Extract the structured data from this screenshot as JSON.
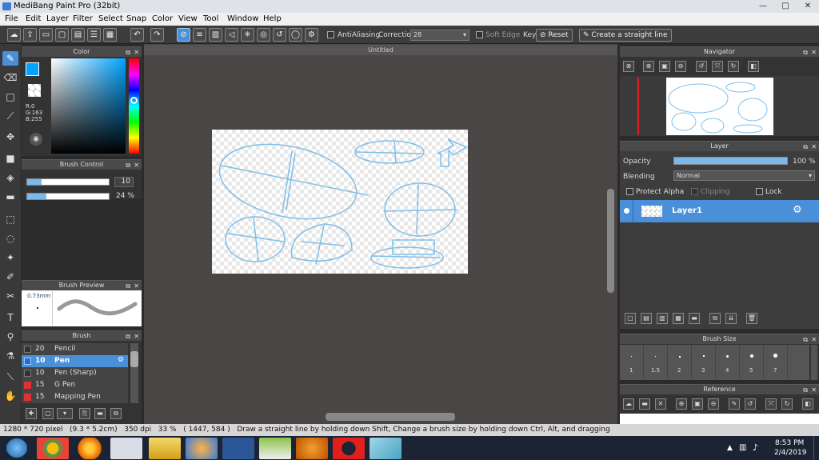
{
  "window": {
    "title": "MediBang Paint Pro (32bit)",
    "minimize": "—",
    "maximize": "□",
    "close": "✕"
  },
  "menu": [
    "File",
    "Edit",
    "Layer",
    "Filter",
    "Select",
    "Snap",
    "Color",
    "View",
    "Tool",
    "Window",
    "Help"
  ],
  "toolbar": {
    "antialiasing": "AntiAliasing",
    "correction_label": "Correction",
    "correction_value": "28",
    "soft_edge": "Soft Edge",
    "key": "Key",
    "reset": "Reset",
    "straight": "Create a straight line"
  },
  "color_panel": {
    "title": "Color",
    "r": "R:0",
    "g": "G:163",
    "b": "B:255",
    "accent": "#00a3ff"
  },
  "brush_control": {
    "title": "Brush Control",
    "size": "10",
    "opacity": "24 %"
  },
  "brush_preview": {
    "title": "Brush Preview",
    "size": "0.73mm"
  },
  "brush_panel": {
    "title": "Brush",
    "items": [
      {
        "size": "20",
        "name": "Pencil",
        "color": "#333333"
      },
      {
        "size": "10",
        "name": "Pen",
        "color": "#4a90d9",
        "selected": true
      },
      {
        "size": "10",
        "name": "Pen (Sharp)",
        "color": "#333333"
      },
      {
        "size": "15",
        "name": "G Pen",
        "color": "#e03030"
      },
      {
        "size": "15",
        "name": "Mapping Pen",
        "color": "#e03030"
      }
    ]
  },
  "document": {
    "tab": "Untitled"
  },
  "navigator": {
    "title": "Navigator"
  },
  "layer_panel": {
    "title": "Layer",
    "opacity_label": "Opacity",
    "opacity_value": "100 %",
    "opacity_fraction": 1.0,
    "blending_label": "Blending",
    "blending_value": "Normal",
    "protect_alpha": "Protect Alpha",
    "clipping": "Clipping",
    "lock": "Lock",
    "layer_name": "Layer1"
  },
  "brush_size": {
    "title": "Brush Size",
    "sizes": [
      "1",
      "1.5",
      "2",
      "3",
      "4",
      "5",
      "7"
    ]
  },
  "reference": {
    "title": "Reference"
  },
  "status": {
    "text": "1280 * 720 pixel   (9.3 * 5.2cm)   350 dpi   33 %   ( 1447, 584 )   Draw a straight line by holding down Shift, Change a brush size by holding down Ctrl, Alt, and dragging"
  },
  "taskbar": {
    "time": "8:53 PM",
    "date": "2/4/2019"
  }
}
